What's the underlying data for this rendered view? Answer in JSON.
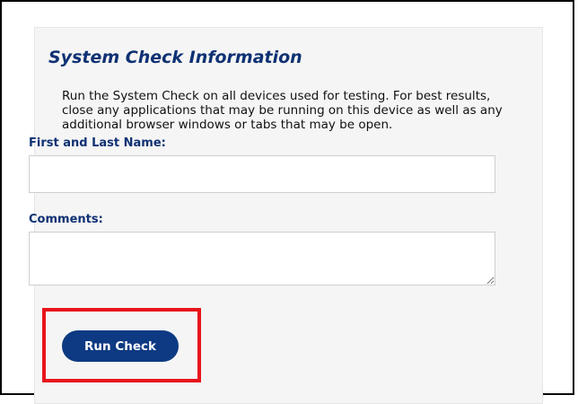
{
  "panel": {
    "title": "System Check Information",
    "description": "Run the System Check on all devices used for testing. For best results, close any applications that may be running on this device as well as any additional browser windows or tabs that may be open."
  },
  "form": {
    "name_label": "First and Last Name:",
    "name_value": "",
    "comments_label": "Comments:",
    "comments_value": "",
    "submit_label": "Run Check"
  },
  "colors": {
    "heading": "#0f3173",
    "button": "#0d3a82",
    "highlight": "#e8141b",
    "card_background": "#f5f5f5"
  }
}
